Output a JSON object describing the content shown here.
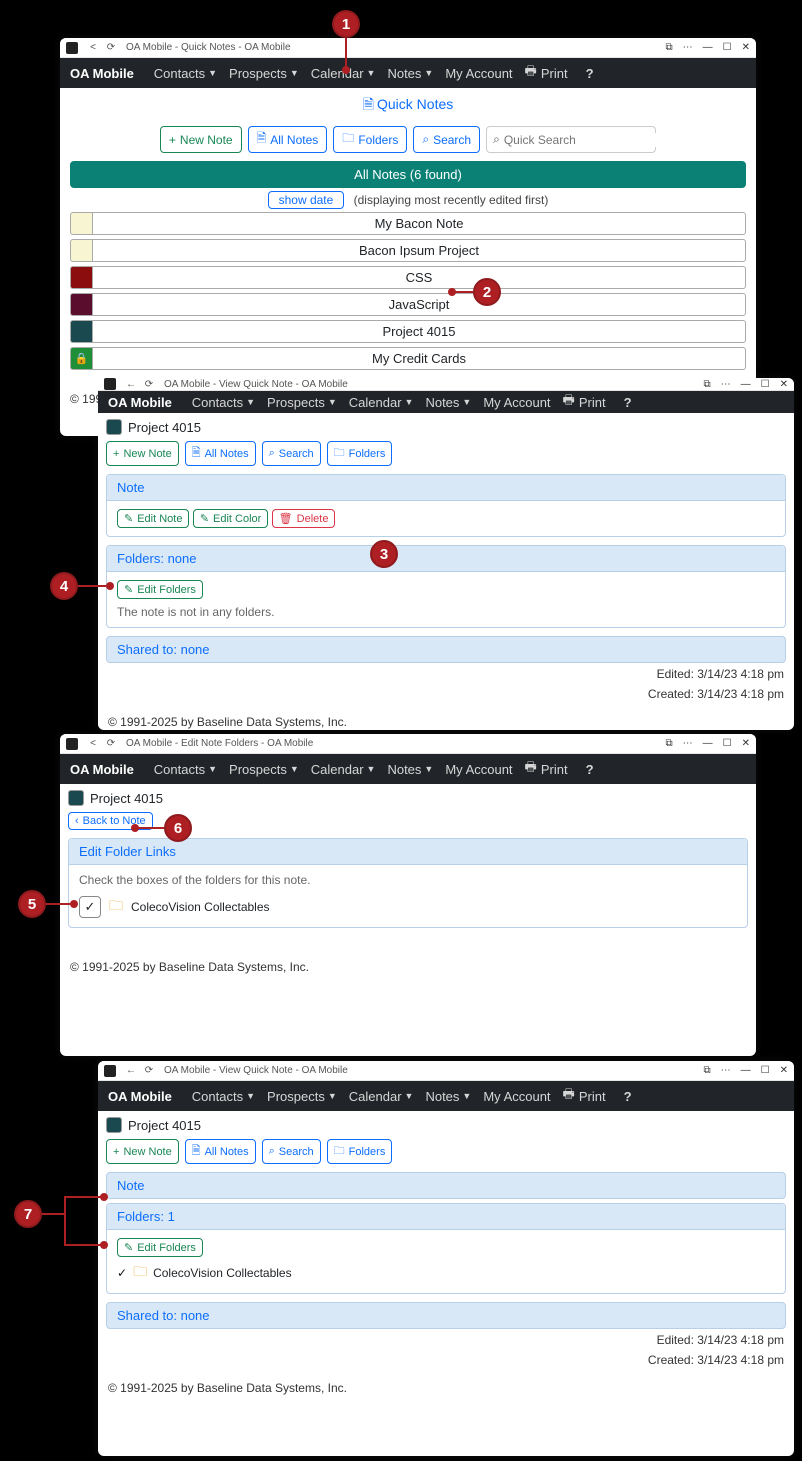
{
  "footer": "© 1991-2025 by Baseline Data Systems, Inc.",
  "nav": {
    "brand": "OA Mobile",
    "items": [
      "Contacts",
      "Prospects",
      "Calendar",
      "Notes",
      "My Account"
    ],
    "print": "Print",
    "help": "?"
  },
  "win1": {
    "title": "OA Mobile - Quick Notes - OA Mobile",
    "pageTitle": "Quick Notes",
    "toolbar": {
      "newNote": "New Note",
      "allNotes": "All Notes",
      "folders": "Folders",
      "search": "Search",
      "quickSearchPlaceholder": "Quick Search"
    },
    "banner": "All Notes (6 found)",
    "showDateBtn": "show date",
    "showDateText": "(displaying most recently edited first)",
    "notes": [
      {
        "label": "My Bacon Note",
        "color": "#f7f5d2"
      },
      {
        "label": "Bacon Ipsum Project",
        "color": "#f7f5d2"
      },
      {
        "label": "CSS",
        "color": "#8b0d0d"
      },
      {
        "label": "JavaScript",
        "color": "#5b0d2d"
      },
      {
        "label": "Project 4015",
        "color": "#1a4a4f"
      },
      {
        "label": "My Credit Cards",
        "color": "#1e8f37",
        "locked": true
      }
    ]
  },
  "win2": {
    "title": "OA Mobile - View Quick Note - OA Mobile",
    "noteTitle": "Project 4015",
    "noteColor": "#1a4a4f",
    "toolbar": {
      "newNote": "New Note",
      "allNotes": "All Notes",
      "search": "Search",
      "folders": "Folders"
    },
    "sectionNote": "Note",
    "editNote": "Edit Note",
    "editColor": "Edit Color",
    "delete": "Delete",
    "foldersHeading": "Folders: none",
    "editFolders": "Edit Folders",
    "noFoldersText": "The note is not in any folders.",
    "sharedHeading": "Shared to: none",
    "edited": "Edited: 3/14/23 4:18 pm",
    "created": "Created: 3/14/23 4:18 pm"
  },
  "win3": {
    "title": "OA Mobile - Edit Note Folders - OA Mobile",
    "noteTitle": "Project 4015",
    "noteColor": "#1a4a4f",
    "backBtn": "Back to Note",
    "heading": "Edit Folder Links",
    "instruction": "Check the boxes of the folders for this note.",
    "folderName": "ColecoVision Collectables"
  },
  "win4": {
    "title": "OA Mobile - View Quick Note - OA Mobile",
    "noteTitle": "Project 4015",
    "noteColor": "#1a4a4f",
    "toolbar": {
      "newNote": "New Note",
      "allNotes": "All Notes",
      "search": "Search",
      "folders": "Folders"
    },
    "sectionNote": "Note",
    "foldersHeading": "Folders: 1",
    "editFolders": "Edit Folders",
    "folderName": "ColecoVision Collectables",
    "sharedHeading": "Shared to: none",
    "edited": "Edited: 3/14/23 4:18 pm",
    "created": "Created: 3/14/23 4:18 pm"
  },
  "steps": {
    "1": "1",
    "2": "2",
    "3": "3",
    "4": "4",
    "5": "5",
    "6": "6",
    "7": "7"
  }
}
